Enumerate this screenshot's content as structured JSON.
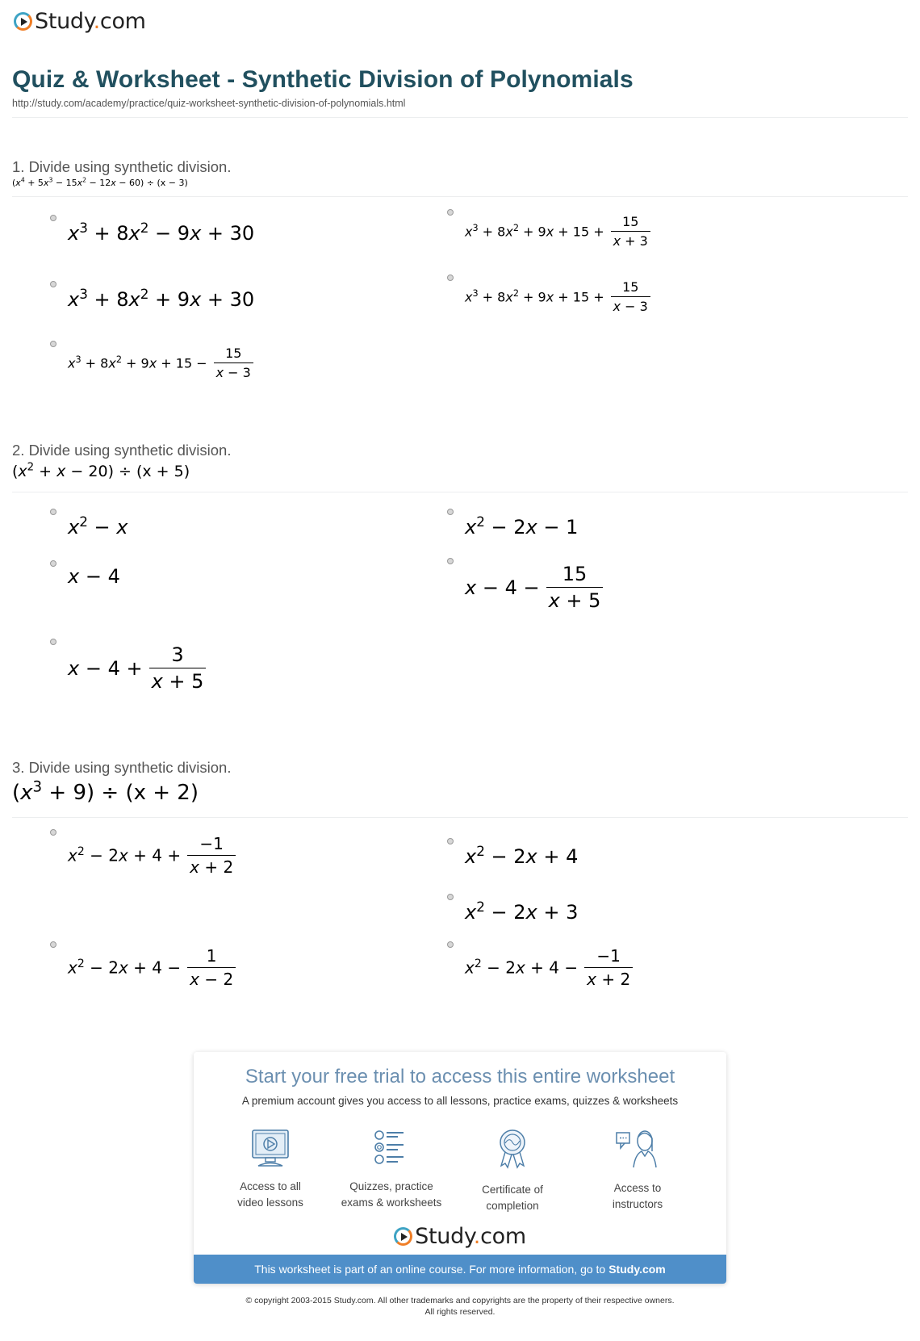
{
  "header": {
    "logo_text": "Study",
    "logo_dot": ".",
    "logo_suffix": "com",
    "title": "Quiz & Worksheet - Synthetic Division of Polynomials",
    "url": "http://study.com/academy/practice/quiz-worksheet-synthetic-division-of-polynomials.html"
  },
  "questions": [
    {
      "heading": "1. Divide using synthetic division.",
      "dividend": [
        "(x",
        "4",
        " + 5x",
        "3",
        " − 15x",
        "2",
        " − 12x − 60)"
      ],
      "divisor": " ÷ (x − 3)",
      "options": [
        {
          "main": "x³ + 8x² − 9x + 30",
          "parts": [
            "x",
            "3",
            " + 8x",
            "2",
            " − 9x + 30"
          ]
        },
        {
          "parts": [
            "x",
            "3",
            " + 8x",
            "2",
            " + 9x + 15 +"
          ],
          "frac_num": "15",
          "frac_den": "x + 3"
        },
        {
          "parts": [
            "x",
            "3",
            " + 8x",
            "2",
            " + 9x + 30"
          ]
        },
        {
          "parts": [
            "x",
            "3",
            " + 8x",
            "2",
            " + 9x + 15 +"
          ],
          "frac_num": "15",
          "frac_den": "x − 3"
        },
        {
          "parts": [
            "x",
            "3",
            " + 8x",
            "2",
            " + 9x + 15 −"
          ],
          "frac_num": "15",
          "frac_den": "x − 3"
        }
      ]
    },
    {
      "heading": "2. Divide using synthetic division.",
      "dividend": [
        "(x",
        "2",
        " + x − 20)"
      ],
      "divisor": " ÷ (x + 5)",
      "options": [
        {
          "parts": [
            "x",
            "2",
            " − x"
          ]
        },
        {
          "parts": [
            "x",
            "2",
            " − 2x − 1"
          ]
        },
        {
          "parts": [
            "x − 4"
          ]
        },
        {
          "parts": [
            "x − 4 −"
          ],
          "frac_num": "15",
          "frac_den": "x + 5"
        },
        {
          "parts": [
            "x − 4 +"
          ],
          "frac_num": "3",
          "frac_den": "x + 5"
        }
      ]
    },
    {
      "heading": "3. Divide using synthetic division.",
      "dividend": [
        "(x",
        "3",
        " + 9)"
      ],
      "divisor": " ÷ (x + 2)",
      "options": [
        {
          "parts": [
            "x",
            "2",
            " − 2x + 4 +"
          ],
          "frac_num": "−1",
          "frac_den": "x + 2"
        },
        {
          "parts": [
            "x",
            "2",
            " − 2x + 4"
          ]
        },
        {
          "parts": [
            "x",
            "2",
            " − 2x + 3"
          ]
        },
        {
          "parts": [
            "x",
            "2",
            " − 2x + 4 −"
          ],
          "frac_num": "1",
          "frac_den": "x − 2"
        },
        {
          "parts": [
            "x",
            "2",
            " − 2x + 4 −"
          ],
          "frac_num": "−1",
          "frac_den": "x + 2"
        }
      ]
    }
  ],
  "promo": {
    "title": "Start your free trial to access this entire worksheet",
    "subtitle": "A premium account gives you access to all lessons, practice exams, quizzes & worksheets",
    "features": [
      {
        "icon": "video-lesson-icon",
        "line1": "Access to all",
        "line2": "video lessons"
      },
      {
        "icon": "quiz-list-icon",
        "line1": "Quizzes, practice",
        "line2": "exams & worksheets"
      },
      {
        "icon": "certificate-icon",
        "line1": "Certificate of",
        "line2": "completion"
      },
      {
        "icon": "instructor-icon",
        "line1": "Access to",
        "line2": "instructors"
      }
    ],
    "bar_text": "This worksheet is part of an online course. For more information, go to",
    "bar_link": "Study.com"
  },
  "footer": {
    "copyright_line1": "© copyright 2003-2015 Study.com. All other trademarks and copyrights are the property of their respective owners.",
    "copyright_line2": "All rights reserved."
  },
  "colors": {
    "title": "#21505f",
    "promo_title": "#6b8fb0",
    "promo_bar": "#4f8fc9",
    "logo_blue": "#3ea3c4",
    "logo_orange": "#f07e26"
  }
}
